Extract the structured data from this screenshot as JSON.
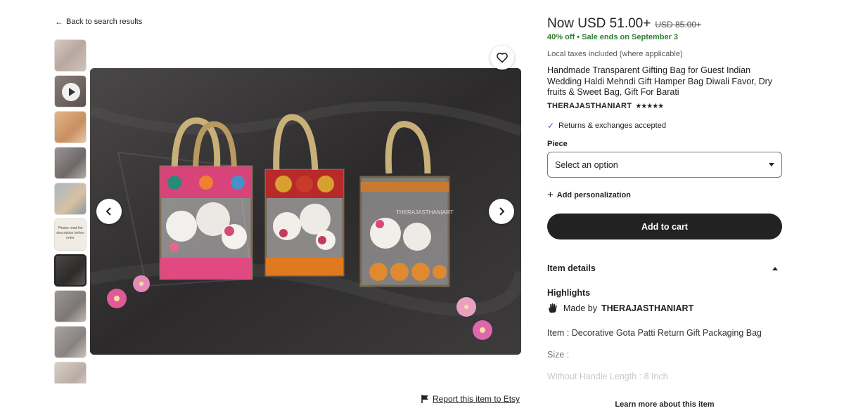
{
  "nav": {
    "back_label": "Back to search results"
  },
  "gallery": {
    "thumbnail_note": "Please read the description before order",
    "watermark": "THERAJASTHANIART",
    "selected_index": 6,
    "report_label": "Report this item to Etsy"
  },
  "listing": {
    "price_now": "Now USD 51.00+",
    "price_was": "USD 85.00+",
    "discount": "40% off",
    "sale_end": "Sale ends on September 3",
    "taxes": "Local taxes included (where applicable)",
    "title": "Handmade Transparent Gifting Bag for Guest Indian Wedding Haldi Mehndi Gift Hamper Bag Diwali Favor, Dry fruits & Sweet Bag, Gift For Barati",
    "shop_name": "THERAJASTHANIART",
    "rating_stars": "★★★★★",
    "returns": "Returns & exchanges accepted",
    "piece_label": "Piece",
    "piece_select": "Select an option",
    "add_personalization": "Add personalization",
    "add_to_cart": "Add to cart"
  },
  "details": {
    "heading": "Item details",
    "highlights": "Highlights",
    "made_by_prefix": "Made by",
    "made_by_shop": "THERAJASTHANIART",
    "item_line": "Item : Decorative Gota Patti Return Gift Packaging Bag",
    "size_line": "Size :",
    "length_line": "Without Handle Length : 8 Inch",
    "learn_more": "Learn more about this item"
  },
  "colors": {
    "sale_green": "#2f7d32",
    "button_dark": "#222222",
    "check_blue": "#2a5fbf"
  }
}
